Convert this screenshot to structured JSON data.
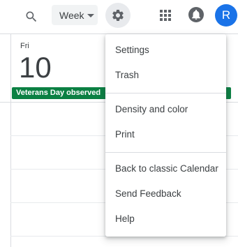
{
  "topbar": {
    "view_label": "Week",
    "avatar_letter": "R",
    "icons": [
      "search-icon",
      "caret-down-icon",
      "gear-icon",
      "apps-grid-icon",
      "notifications-icon"
    ]
  },
  "calendar": {
    "day_name": "Fri",
    "day_number": "10",
    "allday_event": "Veterans Day observed",
    "event_color": "#0b8043"
  },
  "settings_menu": {
    "items": [
      {
        "label": "Settings"
      },
      {
        "label": "Trash"
      },
      {
        "label": "Density and color"
      },
      {
        "label": "Print"
      },
      {
        "label": "Back to classic Calendar"
      },
      {
        "label": "Send Feedback"
      },
      {
        "label": "Help"
      }
    ]
  },
  "colors": {
    "accent": "#1a73e8",
    "settings_button_bg": "#e8eaed",
    "view_select_bg": "#f1f3f4"
  }
}
